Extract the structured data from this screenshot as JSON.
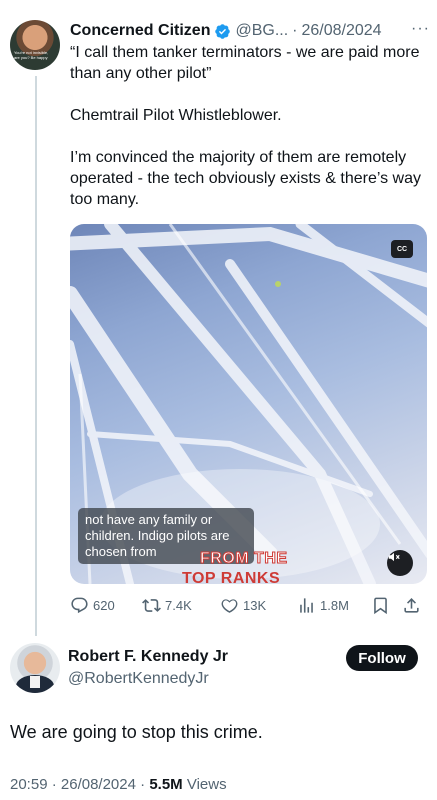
{
  "parent_tweet": {
    "author_name": "Concerned Citizen",
    "author_handle": "@BG...",
    "separator": "·",
    "date": "26/08/2024",
    "more": "···",
    "avatar_text": "You're not invisible, are you? Be happy",
    "text_lines": [
      "“I call them tanker terminators - we are paid more than any other pilot”",
      "Chemtrail Pilot Whistleblower.",
      "I’m convinced the majority of them are remotely operated - the tech obviously exists & there’s way too many."
    ],
    "media": {
      "cc_label": "CC",
      "caption": "not have any family or children. Indigo pilots are chosen from",
      "burned_text_1": "FROM THE",
      "burned_text_2": "TOP RANKS"
    },
    "actions": {
      "replies": "620",
      "reposts": "7.4K",
      "likes": "13K",
      "views": "1.8M"
    }
  },
  "main_tweet": {
    "author_name": "Robert F. Kennedy Jr",
    "author_handle": "@RobertKennedyJr",
    "follow_label": "Follow",
    "text": "We are going to stop this crime.",
    "time": "20:59",
    "separator": "·",
    "date": "26/08/2024",
    "separator2": "·",
    "views_count": "5.5M",
    "views_label": "Views"
  },
  "colors": {
    "verified": "#1d9bf0",
    "text_primary": "#0f1419",
    "text_secondary": "#536471",
    "thread_line": "#cfd9de"
  }
}
